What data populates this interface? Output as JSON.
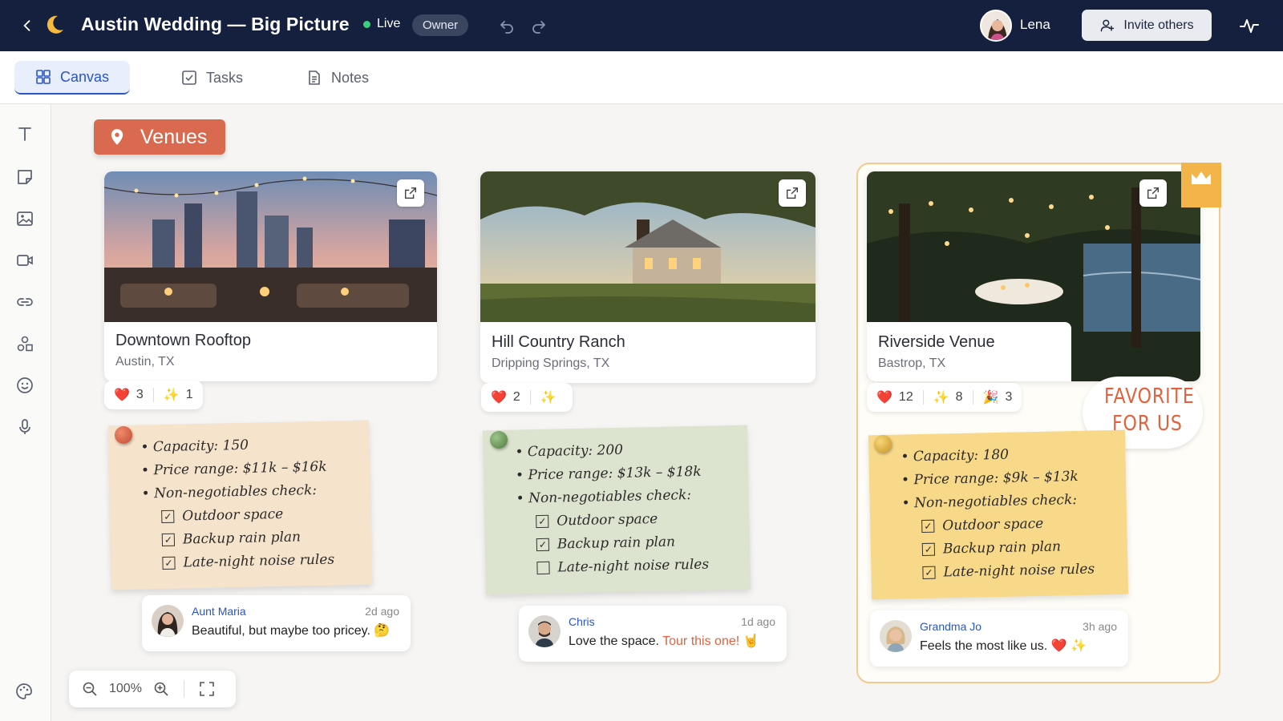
{
  "header": {
    "title": "Austin Wedding — Big Picture",
    "status": "Live",
    "role": "Owner",
    "user_name": "Lena",
    "invite_label": "Invite others"
  },
  "tabs": [
    {
      "label": "Canvas",
      "active": true
    },
    {
      "label": "Tasks",
      "active": false
    },
    {
      "label": "Notes",
      "active": false
    }
  ],
  "section": {
    "label": "Venues"
  },
  "venues": [
    {
      "name": "Downtown Rooftop",
      "location": "Austin, TX",
      "reactions": {
        "heart": "3",
        "sparkle": "1"
      },
      "note": {
        "capacity": "Capacity: 150",
        "price": "Price range: $11k – $16k",
        "check_title": "Non-negotiables check:",
        "items": [
          "Outdoor space",
          "Backup rain plan",
          "Late-night noise rules"
        ],
        "checked": [
          true,
          true,
          true
        ]
      },
      "comment": {
        "author": "Aunt Maria",
        "time": "2d ago",
        "text": "Beautiful, but maybe too pricey.",
        "emoji": "🤔"
      }
    },
    {
      "name": "Hill Country Ranch",
      "location": "Dripping Springs, TX",
      "reactions": {
        "heart": "2",
        "sparkle": ""
      },
      "note": {
        "capacity": "Capacity: 200",
        "price": "Price range: $13k – $18k",
        "check_title": "Non-negotiables check:",
        "items": [
          "Outdoor space",
          "Backup rain plan",
          "Late-night noise rules"
        ],
        "checked": [
          true,
          true,
          false
        ]
      },
      "comment": {
        "author": "Chris",
        "time": "1d ago",
        "text": "Love the space.",
        "highlight": "Tour this one!",
        "emoji": "🤘"
      }
    },
    {
      "name": "Riverside Venue",
      "location": "Bastrop, TX",
      "reactions": {
        "heart": "12",
        "sparkle": "8",
        "party": "3"
      },
      "note": {
        "capacity": "Capacity: 180",
        "price": "Price range: $9k – $13k",
        "check_title": "Non-negotiables check:",
        "items": [
          "Outdoor space",
          "Backup rain plan",
          "Late-night noise rules"
        ],
        "checked": [
          true,
          true,
          true
        ]
      },
      "comment": {
        "author": "Grandma Jo",
        "time": "3h ago",
        "text": "Feels the most like us.",
        "emoji": "❤️ ✨"
      },
      "badge": [
        "FAVORITE",
        "FOR US"
      ]
    }
  ],
  "zoom": {
    "level": "100%"
  },
  "colors": {
    "topbar": "#15203f",
    "accent": "#2a55c9",
    "venues_tag": "#d96a4f",
    "note_peach": "#f6e3cc",
    "note_green": "#dce3cf",
    "note_yellow": "#f8d98a"
  }
}
